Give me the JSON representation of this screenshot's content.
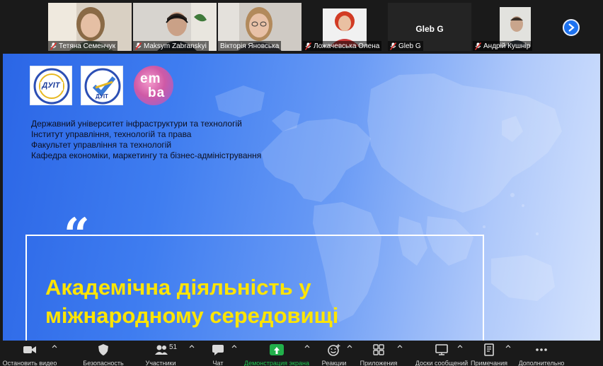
{
  "participants": [
    {
      "name": "Тетяна Семенчук",
      "muted": true,
      "video": true
    },
    {
      "name": "Maksym Zabranskyi",
      "muted": true,
      "video": true
    },
    {
      "name": "Вікторія Яновська",
      "muted": false,
      "video": true,
      "active_speaker": true
    },
    {
      "name": "Ложачевська Олена",
      "muted": true,
      "video": true
    },
    {
      "name": "Gleb G",
      "muted": true,
      "video": false,
      "display_name": "Gleb G"
    },
    {
      "name": "Андрій Кушнір",
      "muted": true,
      "video": true
    }
  ],
  "slide": {
    "logo1_text": "ДУІТ",
    "logo2_text": "ДУІТ",
    "emba_top": "em",
    "emba_bottom": "ba",
    "institution_lines": [
      "Державний університет інфраструктури та технологій",
      "Інститут управління, технологій та права",
      "Факультет управління та технологій",
      "Кафедра економіки, маркетингу та бізнес-адміністрування"
    ],
    "quote_mark": "“",
    "title_lines": [
      "Академічна діяльність у",
      "міжнародному середовищі"
    ]
  },
  "toolbar": {
    "video": "Остановить видео",
    "security": "Безопасность",
    "participants": "Участники",
    "participants_count": "51",
    "chat": "Чат",
    "share": "Демонстрация экрана",
    "reactions": "Реакции",
    "apps": "Приложения",
    "whiteboards": "Доски сообщений",
    "notes": "Примечания",
    "more": "Дополнительно"
  },
  "colors": {
    "accent_blue": "#1d72f0",
    "share_green": "#22b04b",
    "title_yellow": "#ffe500",
    "muted_red": "#e0302c",
    "active_speaker": "#5ec56e"
  }
}
